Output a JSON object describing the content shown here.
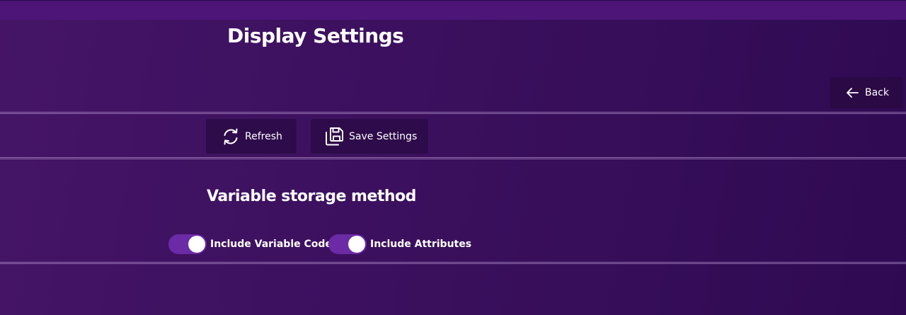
{
  "header": {
    "title": "Display Settings",
    "back_label": "Back"
  },
  "toolbar": {
    "refresh_label": "Refresh",
    "save_label": "Save Settings"
  },
  "storage": {
    "title": "Variable storage method",
    "options": [
      {
        "label": "Include Variable Code",
        "checked": true
      },
      {
        "label": "Include Attributes",
        "checked": true
      }
    ]
  },
  "icons": {
    "back": "arrow-left-icon",
    "refresh": "refresh-icon",
    "save": "save-icon"
  },
  "colors": {
    "background": "#3b105e",
    "top_strip": "#4c1577",
    "button_bg": "#2e0b4a",
    "toggle_on": "#6b2aa6",
    "text": "#ffffff"
  }
}
